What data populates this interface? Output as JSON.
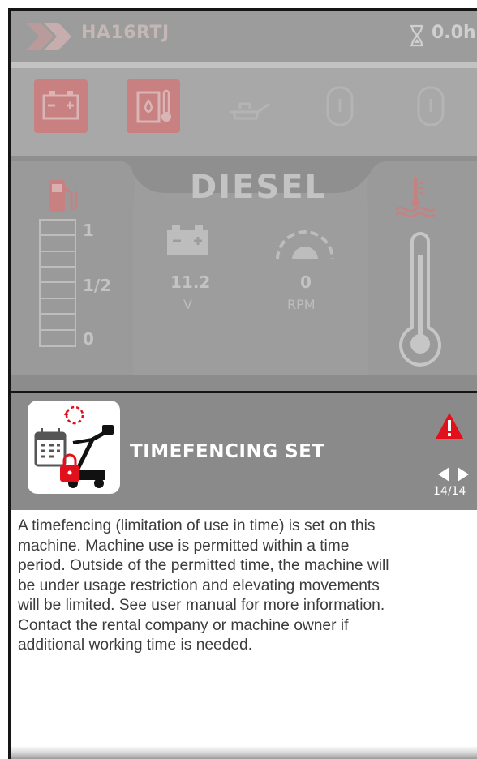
{
  "status_bar": {
    "machine_id": "HA16RTJ",
    "hour_meter": "0.0h"
  },
  "dashboard": {
    "fuel_type": "DIESEL",
    "fuel_levels": [
      "1",
      "1/2",
      "0"
    ],
    "battery_voltage": "11.2",
    "battery_unit": "V",
    "engine_speed": "0",
    "engine_speed_unit": "RPM"
  },
  "alert": {
    "title": "TIMEFENCING SET",
    "page_counter": "14/14",
    "message": "A timefencing (limitation of use in time) is set on this\nmachine. Machine use is permitted within a time\nperiod. Outside of the permitted time, the machine will\nbe under usage restriction and elevating movements\nwill be limited. See user manual for more information.\nContact the rental company or machine owner if\nadditional working time is needed."
  },
  "colors": {
    "alert_header_bg": "#8a8a8a",
    "warning_red": "#e2101a",
    "dim_red": "#c87a7a"
  },
  "icons": [
    "brand-logo-icon",
    "hourglass-icon",
    "battery-warning-icon",
    "hydraulic-temp-warning-icon",
    "oil-icon",
    "fuel-pump-icon",
    "coolant-temp-icon",
    "thermometer-icon",
    "tachometer-icon",
    "timefencing-icon",
    "warning-icon",
    "chevron-left-icon",
    "chevron-right-icon"
  ]
}
